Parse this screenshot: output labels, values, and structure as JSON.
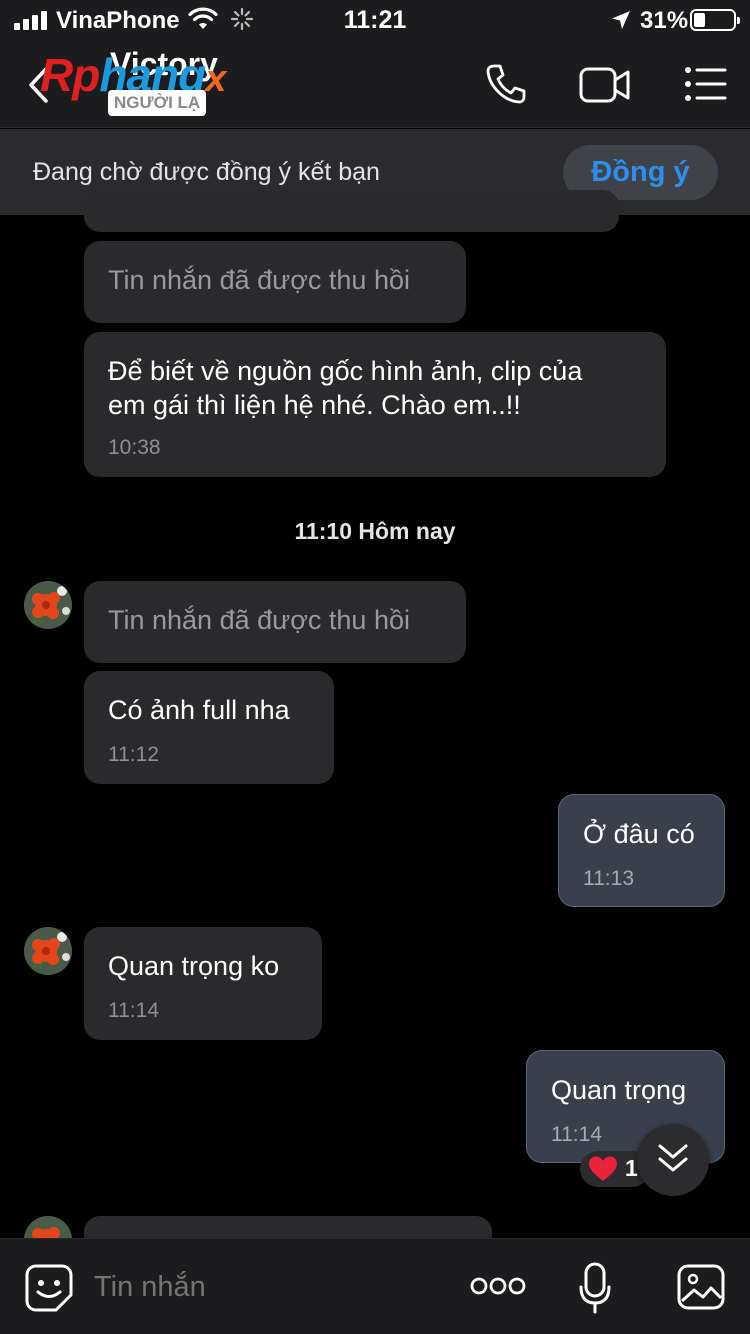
{
  "status_bar": {
    "carrier": "VinaPhone",
    "time": "11:21",
    "battery": "31%"
  },
  "header": {
    "contact_name": "Victory",
    "stranger_label": "NGƯỜI LẠ",
    "watermark": {
      "part1": "Rp",
      "part2": "hang",
      "part3": "x"
    }
  },
  "friend_banner": {
    "text": "Đang chờ được đồng ý kết bạn",
    "accept_label": "Đồng ý"
  },
  "messages": [
    {
      "text": "Tin nhắn đã được thu hồi",
      "time": ""
    },
    {
      "line1": "Để biết về nguồn gốc hình ảnh, clip của",
      "line2": "em gái thì liện hệ nhé. Chào em..!!",
      "time": "10:38"
    },
    {
      "text": "Tin nhắn đã được thu hồi",
      "time": ""
    },
    {
      "text": "Có ảnh full nha",
      "time": "11:12"
    },
    {
      "text": "Ở đâu có",
      "time": "11:13"
    },
    {
      "text": "Quan trọng ko",
      "time": "11:14"
    },
    {
      "text": "Quan trọng",
      "time": "11:14"
    }
  ],
  "date_separator": "11:10 Hôm nay",
  "reaction": {
    "count": "1",
    "icon": "heart-icon",
    "color": "#e8233a"
  },
  "composer": {
    "placeholder": "Tin nhắn"
  },
  "colors": {
    "accent": "#2e8ef0",
    "incoming_bubble": "#2a2a2c",
    "outgoing_bubble": "#37404c",
    "background": "#000000"
  }
}
